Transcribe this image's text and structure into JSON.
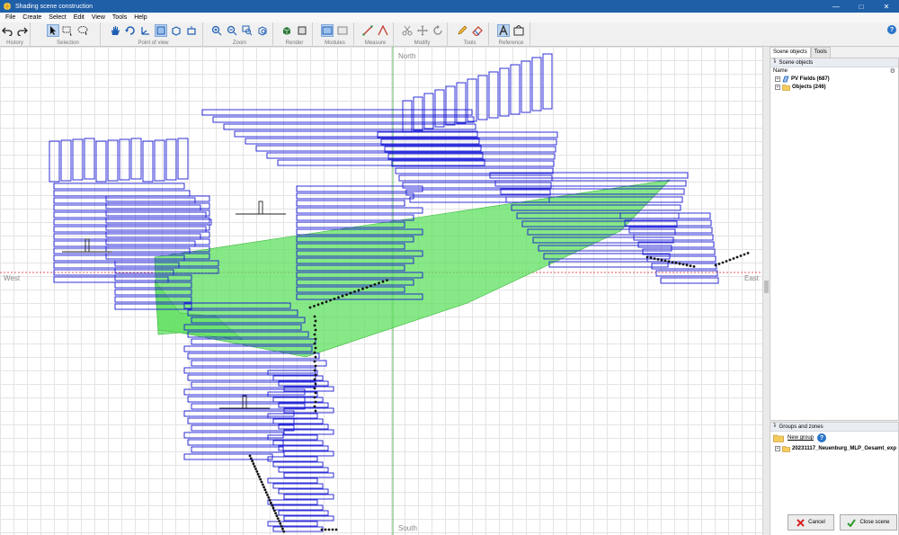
{
  "window": {
    "title": "Shading scene construction",
    "controls": [
      "—",
      "□",
      "✕"
    ]
  },
  "menu": [
    "File",
    "Create",
    "Select",
    "Edit",
    "View",
    "Tools",
    "Help"
  ],
  "toolbar": {
    "groups": [
      {
        "label": "History",
        "icons": [
          "undo-icon",
          "redo-icon"
        ]
      },
      {
        "label": "Selection",
        "icons": [
          "pointer-icon",
          "rect-select-icon",
          "lasso-select-icon"
        ]
      },
      {
        "label": "Point of view",
        "icons": [
          "pan-hand-icon",
          "rotate-icon",
          "axes-icon",
          "view-top-icon",
          "view-iso-icon",
          "view-side-icon"
        ]
      },
      {
        "label": "Zoom",
        "icons": [
          "zoom-in-icon",
          "zoom-out-icon",
          "zoom-window-icon",
          "zoom-fit-icon"
        ]
      },
      {
        "label": "Render",
        "icons": [
          "render-solid-icon",
          "render-wire-icon"
        ]
      },
      {
        "label": "Modules",
        "icons": [
          "modules-on-icon",
          "modules-off-icon"
        ]
      },
      {
        "label": "Measure",
        "icons": [
          "measure-distance-icon",
          "measure-angle-icon"
        ]
      },
      {
        "label": "Modify",
        "icons": [
          "scissors-icon",
          "move-icon",
          "rotate-object-icon"
        ]
      },
      {
        "label": "Tools",
        "icons": [
          "pencil-icon",
          "eraser-icon"
        ]
      },
      {
        "label": "Reference",
        "icons": [
          "reference-a-icon",
          "reference-image-icon"
        ]
      }
    ]
  },
  "compass": {
    "north": "North",
    "south": "South",
    "west": "West",
    "east": "East"
  },
  "panel": {
    "tabs": [
      "Scene objects",
      "Tools"
    ],
    "scene_objects_title": "Scene objects",
    "name_header": "Name",
    "tree": [
      {
        "label": "PV Fields (687)",
        "icon": "pv-field-icon"
      },
      {
        "label": "Objects (246)",
        "icon": "objects-folder-icon"
      }
    ],
    "groups_title": "Groups and zones",
    "new_group": "New group",
    "group_item": "20231117_Neuenburg_MLP_Gesamt_exp"
  },
  "buttons": {
    "cancel": "Cancel",
    "close_scene": "Close scene"
  },
  "colors": {
    "pv_table": "#1a1ad6",
    "shade_zone": "#5ee05e",
    "ref_line": "#e02020",
    "axis_line": "#3aa53a",
    "accent": "#1f5fa8"
  }
}
